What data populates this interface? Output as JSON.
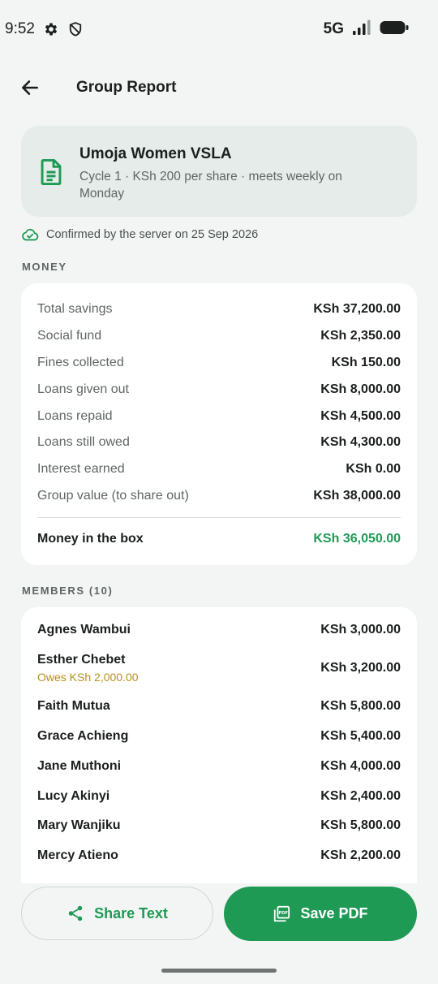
{
  "status_bar": {
    "time": "9:52",
    "network": "5G"
  },
  "header": {
    "title": "Group Report"
  },
  "group": {
    "name": "Umoja Women VSLA",
    "meta_line1": "Cycle 1 · KSh 200 per share · meets weekly on",
    "meta_line2": "Monday"
  },
  "confirmation": {
    "text": "Confirmed by the server on 25 Sep 2026"
  },
  "money": {
    "section_label": "MONEY",
    "rows": [
      {
        "label": "Total savings",
        "value": "KSh 37,200.00"
      },
      {
        "label": "Social fund",
        "value": "KSh 2,350.00"
      },
      {
        "label": "Fines collected",
        "value": "KSh 150.00"
      },
      {
        "label": "Loans given out",
        "value": "KSh 8,000.00"
      },
      {
        "label": "Loans repaid",
        "value": "KSh 4,500.00"
      },
      {
        "label": "Loans still owed",
        "value": "KSh 4,300.00"
      },
      {
        "label": "Interest earned",
        "value": "KSh 0.00"
      },
      {
        "label": "Group value (to share out)",
        "value": "KSh 38,000.00"
      }
    ],
    "total": {
      "label": "Money in the box",
      "value": "KSh 36,050.00"
    }
  },
  "members": {
    "section_label": "MEMBERS (10)",
    "rows": [
      {
        "name": "Agnes Wambui",
        "value": "KSh 3,000.00"
      },
      {
        "name": "Esther Chebet",
        "owes": "Owes KSh 2,000.00",
        "value": "KSh 3,200.00"
      },
      {
        "name": "Faith Mutua",
        "value": "KSh 5,800.00"
      },
      {
        "name": "Grace Achieng",
        "value": "KSh 5,400.00"
      },
      {
        "name": "Jane Muthoni",
        "value": "KSh 4,000.00"
      },
      {
        "name": "Lucy Akinyi",
        "value": "KSh 2,400.00"
      },
      {
        "name": "Mary Wanjiku",
        "value": "KSh 5,800.00"
      },
      {
        "name": "Mercy Atieno",
        "value": "KSh 2,200.00"
      }
    ]
  },
  "actions": {
    "share_label": "Share Text",
    "pdf_label": "Save PDF"
  },
  "colors": {
    "accent": "#1E9A55",
    "owes": "#B8901A",
    "background": "#F3F5F4",
    "group_card": "#E6ECE9"
  },
  "icons": {
    "back": "arrow-left-icon",
    "document": "document-icon",
    "cloud_check": "cloud-check-icon",
    "share": "share-icon",
    "pdf": "pdf-icon",
    "settings": "gear-icon",
    "shield": "shield-icon",
    "signal": "signal-icon",
    "battery": "battery-icon"
  }
}
